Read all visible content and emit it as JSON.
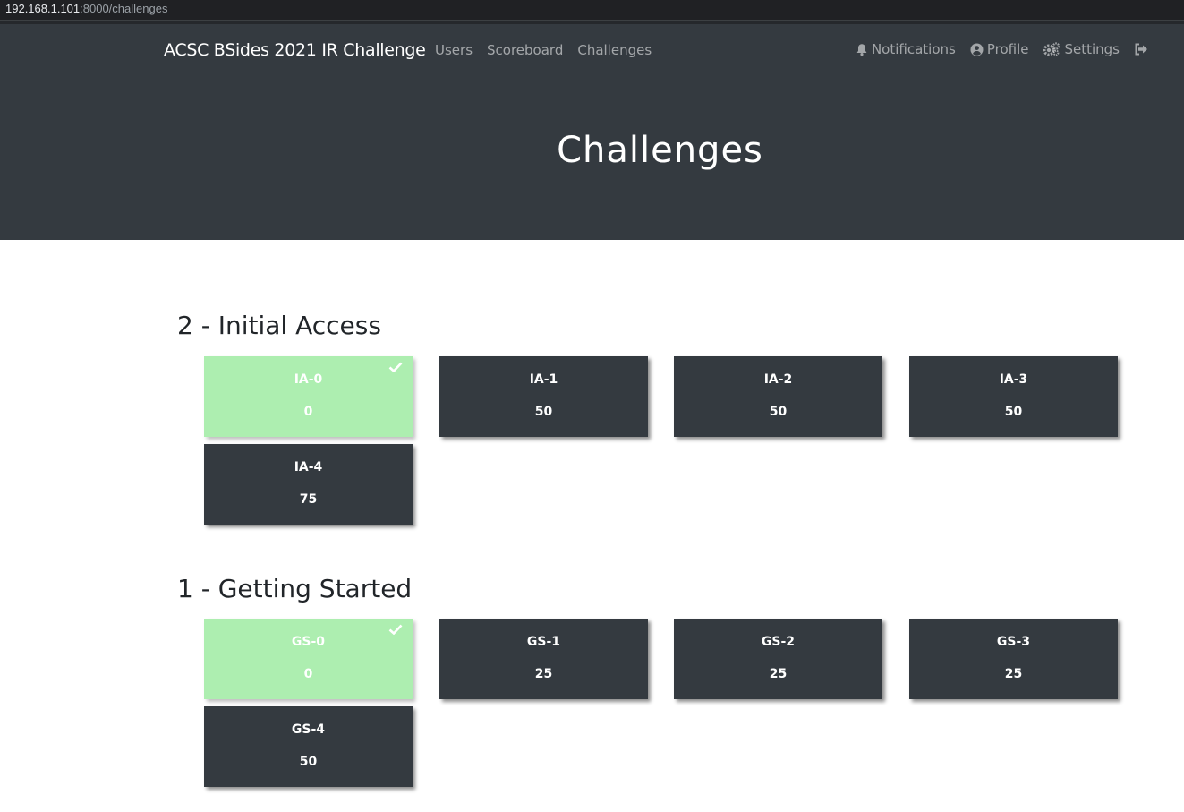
{
  "browser": {
    "url_host": "192.168.1.101",
    "url_rest": ":8000/challenges"
  },
  "nav": {
    "brand": "ACSC BSides 2021 IR Challenge",
    "links": [
      "Users",
      "Scoreboard",
      "Challenges"
    ],
    "notifications": "Notifications",
    "profile": "Profile",
    "settings": "Settings"
  },
  "page": {
    "title": "Challenges"
  },
  "categories": [
    {
      "name": "2 - Initial Access",
      "challenges": [
        {
          "name": "IA-0",
          "value": "0",
          "solved": true
        },
        {
          "name": "IA-1",
          "value": "50",
          "solved": false
        },
        {
          "name": "IA-2",
          "value": "50",
          "solved": false
        },
        {
          "name": "IA-3",
          "value": "50",
          "solved": false
        },
        {
          "name": "IA-4",
          "value": "75",
          "solved": false
        }
      ]
    },
    {
      "name": "1 - Getting Started",
      "challenges": [
        {
          "name": "GS-0",
          "value": "0",
          "solved": true
        },
        {
          "name": "GS-1",
          "value": "25",
          "solved": false
        },
        {
          "name": "GS-2",
          "value": "25",
          "solved": false
        },
        {
          "name": "GS-3",
          "value": "25",
          "solved": false
        },
        {
          "name": "GS-4",
          "value": "50",
          "solved": false
        }
      ]
    }
  ],
  "colors": {
    "navbar": "#343a40",
    "card_unsolved": "#343a40",
    "card_solved": "#adeeb0"
  },
  "icons": {
    "notifications": "bell-icon",
    "profile": "user-circle-icon",
    "settings": "cogs-icon",
    "logout": "sign-out-icon",
    "solved": "check-icon"
  }
}
